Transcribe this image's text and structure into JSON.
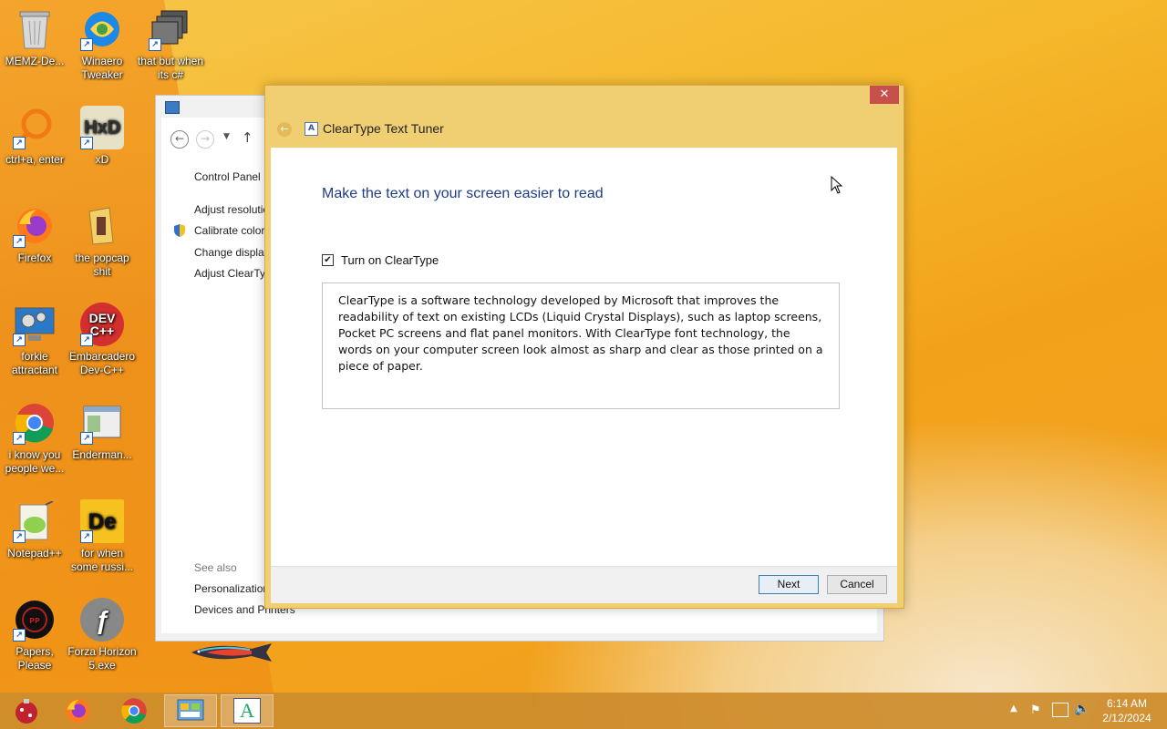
{
  "desktop": {
    "icons": [
      {
        "label": "MEMZ-De...",
        "icon": "recycle-bin-icon"
      },
      {
        "label": "Winaero Tweaker",
        "icon": "winaero-tweaker-icon"
      },
      {
        "label": "that but when its c#",
        "icon": "stacked-windows-icon"
      },
      {
        "label": "ctrl+a, enter",
        "icon": "magnifier-icon"
      },
      {
        "label": "xD",
        "icon": "hxd-icon"
      },
      {
        "label": "Firefox",
        "icon": "firefox-icon"
      },
      {
        "label": "the popcap shit",
        "icon": "folder-icon"
      },
      {
        "label": "forkie attractant",
        "icon": "monitor-gears-icon"
      },
      {
        "label": "Embarcadero Dev-C++",
        "icon": "devcpp-icon"
      },
      {
        "label": "i know you people we...",
        "icon": "chrome-icon"
      },
      {
        "label": "Enderman...",
        "icon": "window-icon"
      },
      {
        "label": "Notepad++",
        "icon": "notepadpp-icon"
      },
      {
        "label": "for when some russi...",
        "icon": "de-icon"
      },
      {
        "label": "Papers, Please",
        "icon": "papers-please-icon"
      },
      {
        "label": "Forza Horizon 5.exe",
        "icon": "flash-icon"
      }
    ]
  },
  "control_panel": {
    "breadcrumb": "Control Panel H",
    "links": [
      "Adjust resolutio",
      "Calibrate color",
      "Change display",
      "Adjust ClearTyp"
    ],
    "see_also_label": "See also",
    "see_also": [
      "Personalization",
      "Devices and Printers"
    ]
  },
  "dialog": {
    "title": "ClearType Text Tuner",
    "close": "✕",
    "heading": "Make the text on your screen easier to read",
    "checkbox_label": "Turn on ClearType",
    "checkbox_checked": "✔",
    "description": "ClearType is a software technology developed by Microsoft that improves the readability of text on existing LCDs (Liquid Crystal Displays), such as laptop screens, Pocket PC screens and flat panel monitors. With ClearType font technology, the words on your computer screen look almost as sharp and clear as those printed on a piece of paper.",
    "next_label": "Next",
    "cancel_label": "Cancel"
  },
  "taskbar": {
    "items": [
      "start-ornament-icon",
      "firefox-icon",
      "chrome-icon",
      "control-panel-icon",
      "cleartype-tuner-icon"
    ],
    "time": "6:14 AM",
    "date": "2/12/2024"
  }
}
